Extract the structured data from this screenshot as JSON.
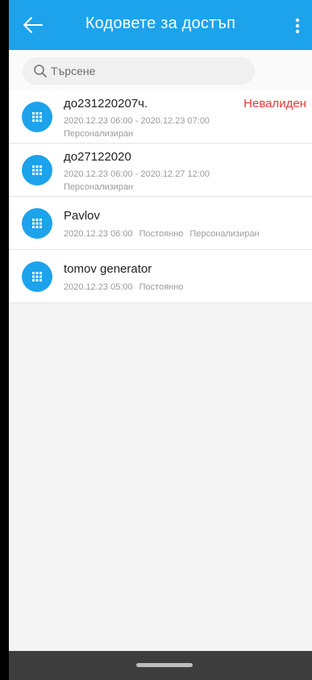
{
  "header": {
    "title": "Кодовете за достъп",
    "icons": {
      "back": "arrow-left-icon",
      "menu": "more-vertical-icon"
    }
  },
  "search": {
    "placeholder": "Търсене",
    "icon": "search-icon"
  },
  "colors": {
    "accent": "#1ca3ec",
    "invalid": "#e8373a"
  },
  "codes": [
    {
      "name": "до231220207ч.",
      "status": "Невалиден",
      "period": "2020.12.23 06:00 - 2020.12.23 07:00",
      "type": "Персонализиран"
    },
    {
      "name": "до27122020",
      "period": "2020.12.23 06:00 - 2020.12.27 12:00",
      "type": "Персонализиран"
    },
    {
      "name": "Pavlov",
      "start": "2020.12.23 06:00",
      "validity": "Постоянно",
      "type": "Персонализиран"
    },
    {
      "name": "tomov generator",
      "start": "2020.12.23 05:00",
      "validity": "Постоянно"
    }
  ]
}
